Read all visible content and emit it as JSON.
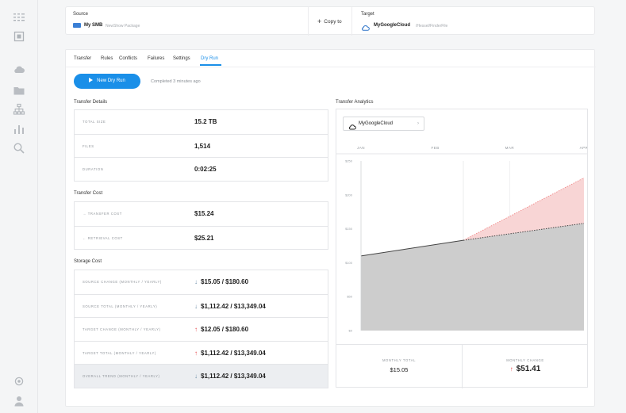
{
  "sidebar": {
    "icons": [
      "menu-icon",
      "box-icon",
      "cloud-icon",
      "folder-icon",
      "org-tree-icon",
      "bar-chart-icon",
      "search-icon",
      "settings-icon",
      "user-icon"
    ]
  },
  "topbar": {
    "source_label": "Source",
    "source_name": "My SMB",
    "source_path": "NewShow Package",
    "copy_label": "Copy to",
    "target_label": "Target",
    "target_name": "MyGoogleCloud",
    "target_path": "/Hessel/FinderFile"
  },
  "tabs": [
    {
      "label": "Transfer"
    },
    {
      "label": "Rules"
    },
    {
      "label": "Conflicts"
    },
    {
      "label": "Failures"
    },
    {
      "label": "Settings"
    },
    {
      "label": "Dry Run",
      "active": true
    }
  ],
  "dryrun": {
    "button_label": "New Dry Run",
    "completed_text": "Completed 3 minutes ago"
  },
  "transfer_details": {
    "title": "Transfer Details",
    "rows": [
      {
        "key": "Total Size",
        "value": "15.2 TB"
      },
      {
        "key": "Files",
        "value": "1,514"
      },
      {
        "key": "Duration",
        "value": "0:02:25"
      }
    ]
  },
  "transfer_cost": {
    "title": "Transfer Cost",
    "rows": [
      {
        "key": "Transfer Cost",
        "value": "$15.24"
      },
      {
        "key": "Retrieval Cost",
        "value": "$25.21"
      }
    ]
  },
  "storage_cost": {
    "title": "Storage Cost",
    "rows": [
      {
        "key": "Source Change (Monthly / Yearly)",
        "value": "$15.05 / $180.60",
        "trend": "down"
      },
      {
        "key": "Source Total (Monthly / Yearly)",
        "value": "$1,112.42 / $13,349.04",
        "trend": "down"
      },
      {
        "key": "Target Change (Monthly / Yearly)",
        "value": "$12.05 / $180.60",
        "trend": "up"
      },
      {
        "key": "Target Total (Monthly / Yearly)",
        "value": "$1,112.42 / $13,349.04",
        "trend": "up"
      },
      {
        "key": "Overall Trend (Monthly / Yearly)",
        "value": "$1,112.42 / $13,349.04",
        "trend": "down"
      }
    ]
  },
  "analytics": {
    "title": "Transfer Analytics",
    "cloud_selector": "MyGoogleCloud",
    "monthly_total_label": "Monthly Total",
    "monthly_total_value": "$15.05",
    "monthly_change_label": "Monthly Change",
    "monthly_change_value": "$51.41"
  },
  "chart_data": {
    "type": "area",
    "x": [
      "JAN",
      "FEB",
      "MAR",
      "APR"
    ],
    "y_ticks": [
      "$0",
      "$50",
      "$100",
      "$150",
      "$200",
      "$250"
    ],
    "ylim": [
      0,
      250
    ],
    "grid": true,
    "series": [
      {
        "color": "#c9c9c9",
        "points": [
          [
            0,
            110
          ],
          [
            1,
            133
          ],
          [
            2,
            158
          ]
        ]
      },
      {
        "color": "#f9d3d3",
        "points": [
          [
            1,
            133
          ],
          [
            2,
            225
          ]
        ]
      }
    ],
    "split_x": 1,
    "xlabel": "",
    "ylabel": "",
    "colors": {
      "area": "#cdcdcd",
      "increase": "#f8d5d5",
      "increase_line": "#f08080"
    }
  }
}
